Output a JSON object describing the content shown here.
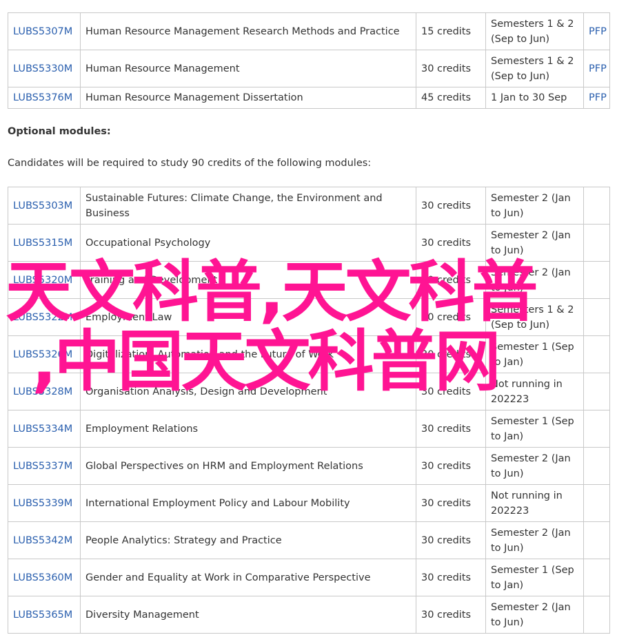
{
  "core_modules": [
    {
      "code": "LUBS5307M",
      "title": "Human Resource Management Research Methods and Practice",
      "credits": "15 credits",
      "semester_l1": "Semesters 1 & 2",
      "semester_l2": "(Sep to Jun)",
      "pfp": "PFP"
    },
    {
      "code": "LUBS5330M",
      "title": "Human Resource Management",
      "credits": "30 credits",
      "semester_l1": "Semesters 1 & 2",
      "semester_l2": "(Sep to Jun)",
      "pfp": "PFP"
    },
    {
      "code": "LUBS5376M",
      "title": "Human Resource Management Dissertation",
      "credits": "45 credits",
      "semester_l1": "1 Jan to 30 Sep",
      "semester_l2": "",
      "pfp": "PFP"
    }
  ],
  "optional": {
    "heading": "Optional modules:",
    "intro": "Candidates will be required to study 90 credits of the following modules:"
  },
  "optional_modules": [
    {
      "code": "LUBS5303M",
      "title": "Sustainable Futures: Climate Change, the Environment and Business",
      "credits": "30 credits",
      "semester_l1": "Semester 2 (Jan",
      "semester_l2": "to Jun)"
    },
    {
      "code": "LUBS5315M",
      "title": "Occupational Psychology",
      "credits": "30 credits",
      "semester_l1": "Semester 2 (Jan",
      "semester_l2": "to Jun)"
    },
    {
      "code": "LUBS5320M",
      "title": "Training and Development",
      "credits": "30 credits",
      "semester_l1": "Semester 2 (Jan",
      "semester_l2": "to Jun)"
    },
    {
      "code": "LUBS5322M",
      "title": "Employment Law",
      "credits": "30 credits",
      "semester_l1": "Semesters 1 & 2",
      "semester_l2": "(Sep to Jun)"
    },
    {
      "code": "LUBS5326M",
      "title": "Digitalization, Automation and the Future of Work",
      "credits": "30 credits",
      "semester_l1": "Semester 1 (Sep",
      "semester_l2": "to Jan)"
    },
    {
      "code": "LUBS5328M",
      "title": "Organisation Analysis, Design and Development",
      "credits": "30 credits",
      "semester_l1": "Not running in",
      "semester_l2": "202223"
    },
    {
      "code": "LUBS5334M",
      "title": "Employment Relations",
      "credits": "30 credits",
      "semester_l1": "Semester 1 (Sep",
      "semester_l2": "to Jan)"
    },
    {
      "code": "LUBS5337M",
      "title": "Global Perspectives on HRM and Employment Relations",
      "credits": "30 credits",
      "semester_l1": "Semester 2 (Jan",
      "semester_l2": "to Jun)"
    },
    {
      "code": "LUBS5339M",
      "title": "International Employment Policy and Labour Mobility",
      "credits": "30 credits",
      "semester_l1": "Not running in",
      "semester_l2": "202223"
    },
    {
      "code": "LUBS5342M",
      "title": "People Analytics: Strategy and Practice",
      "credits": "30 credits",
      "semester_l1": "Semester 2 (Jan",
      "semester_l2": "to Jun)"
    },
    {
      "code": "LUBS5360M",
      "title": "Gender and Equality at Work in Comparative Perspective",
      "credits": "30 credits",
      "semester_l1": "Semester 1 (Sep",
      "semester_l2": "to Jan)"
    },
    {
      "code": "LUBS5365M",
      "title": "Diversity Management",
      "credits": "30 credits",
      "semester_l1": "Semester 2 (Jan",
      "semester_l2": "to Jun)"
    }
  ],
  "watermark": {
    "line1": "天文科普,天文科普",
    "line2": ",中国天文科普网",
    "color": "#ff1493"
  },
  "colors": {
    "link": "#2a5fae",
    "text": "#333333",
    "border": "#c8c8c8"
  }
}
